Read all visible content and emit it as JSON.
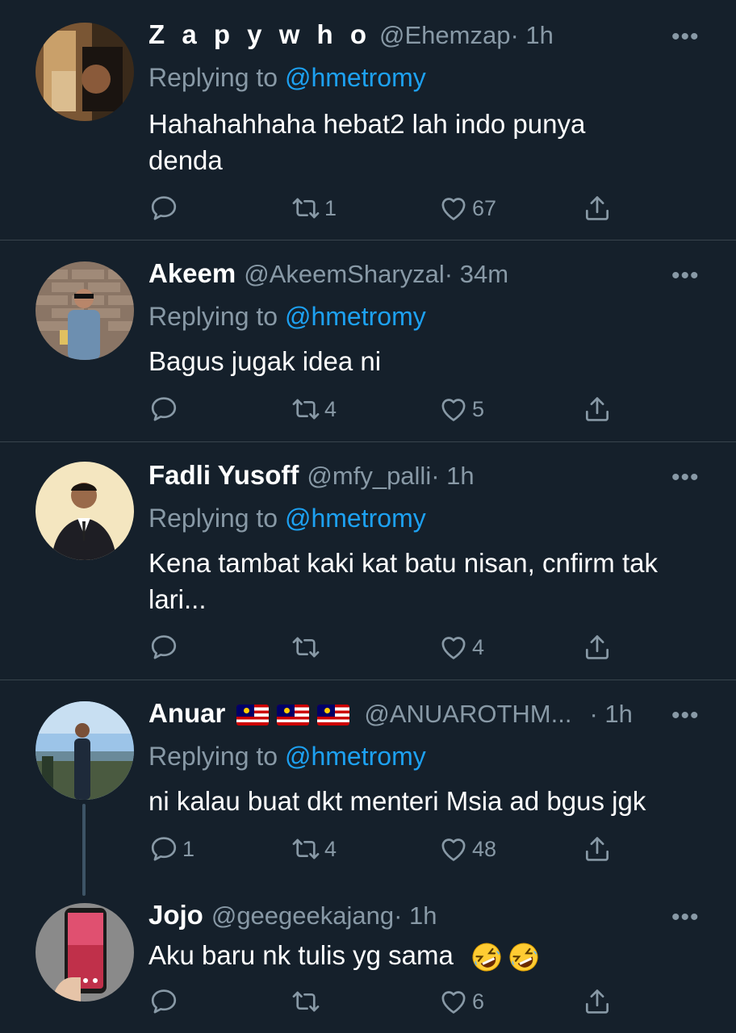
{
  "colors": {
    "background": "#15202b",
    "divider": "#38444d",
    "muted": "#8899a6",
    "link": "#1da1f2",
    "text": "#ffffff"
  },
  "more_label": "•••",
  "tweets": [
    {
      "name": "Z a p y w h o",
      "handle": "@Ehemzap",
      "time": "· 1h",
      "replying_prefix": "Replying to ",
      "replying_to": "@hmetromy",
      "text": "Hahahahhaha hebat2 lah indo punya denda",
      "replies": "",
      "retweets": "1",
      "likes": "67"
    },
    {
      "name": "Akeem",
      "handle": "@AkeemSharyzal",
      "time": "· 34m",
      "replying_prefix": "Replying to ",
      "replying_to": "@hmetromy",
      "text": "Bagus jugak idea ni",
      "replies": "",
      "retweets": "4",
      "likes": "5"
    },
    {
      "name": "Fadli Yusoff",
      "handle": "@mfy_palli",
      "time": "· 1h",
      "replying_prefix": "Replying to ",
      "replying_to": "@hmetromy",
      "text": "Kena tambat kaki kat batu nisan, cnfirm tak lari...",
      "replies": "",
      "retweets": "",
      "likes": "4"
    },
    {
      "name": "Anuar",
      "flag_icons": [
        "malaysia-flag-icon",
        "malaysia-flag-icon",
        "malaysia-flag-icon"
      ],
      "handle": "@ANUAROTHM...",
      "time": "· 1h",
      "replying_prefix": "Replying to ",
      "replying_to": "@hmetromy",
      "text": "ni kalau buat dkt menteri Msia ad bgus jgk",
      "replies": "1",
      "retweets": "4",
      "likes": "48"
    },
    {
      "name": "Jojo",
      "handle": "@geegeekajang",
      "time": "· 1h",
      "text": "Aku baru nk tulis yg sama",
      "emoji_icons": [
        "rolling-on-floor-laughing-emoji",
        "rolling-on-floor-laughing-emoji"
      ],
      "replies": "",
      "retweets": "",
      "likes": "6"
    }
  ]
}
